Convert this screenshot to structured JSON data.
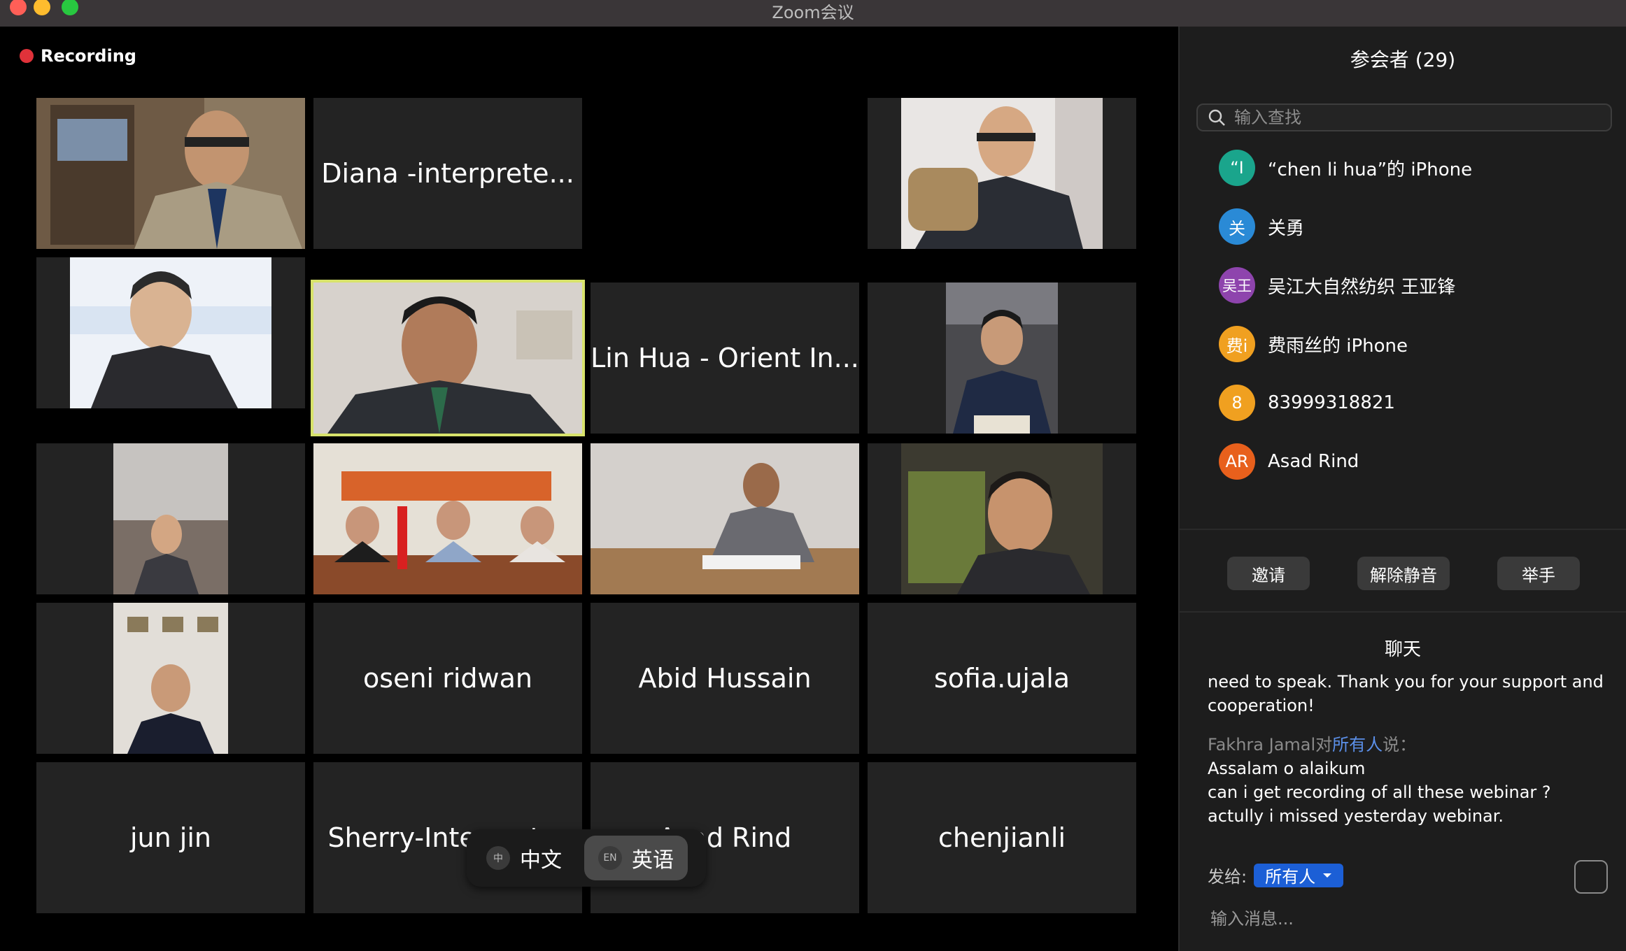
{
  "window": {
    "title": "Zoom会议"
  },
  "recording": {
    "label": "Recording"
  },
  "video_grid": {
    "tiles": [
      {
        "type": "video",
        "label": ""
      },
      {
        "type": "name",
        "label": "Diana -interprete..."
      },
      {
        "type": "empty",
        "label": ""
      },
      {
        "type": "video",
        "label": ""
      },
      {
        "type": "video",
        "label": ""
      },
      {
        "type": "video",
        "label": "",
        "active": true
      },
      {
        "type": "name",
        "label": "Lin Hua - Orient In..."
      },
      {
        "type": "video",
        "label": ""
      },
      {
        "type": "video",
        "label": ""
      },
      {
        "type": "video",
        "label": ""
      },
      {
        "type": "video",
        "label": ""
      },
      {
        "type": "video",
        "label": ""
      },
      {
        "type": "video",
        "label": ""
      },
      {
        "type": "name",
        "label": "oseni ridwan"
      },
      {
        "type": "name",
        "label": "Abid Hussain"
      },
      {
        "type": "name",
        "label": "sofia.ujala"
      },
      {
        "type": "name",
        "label": "jun jin"
      },
      {
        "type": "name",
        "label": "Sherry-Interpreter"
      },
      {
        "type": "name",
        "label": "Asad Rind"
      },
      {
        "type": "name",
        "label": "chenjianli"
      }
    ]
  },
  "interpretation": {
    "options": [
      {
        "icon_text": "中",
        "label": "中文",
        "selected": false
      },
      {
        "icon_text": "EN",
        "label": "英语",
        "selected": true
      }
    ]
  },
  "participants": {
    "title": "参会者 (29)",
    "search_placeholder": "输入查找",
    "items": [
      {
        "initials": "“I",
        "name": "“chen li hua”的 iPhone",
        "color": "#1aa58c"
      },
      {
        "initials": "关",
        "name": "关勇",
        "color": "#2a8ad6"
      },
      {
        "initials": "吴王",
        "name": "吴江大自然纺织 王亚锋",
        "color": "#8e44ad"
      },
      {
        "initials": "费i",
        "name": "费雨丝的 iPhone",
        "color": "#f0a020"
      },
      {
        "initials": "8",
        "name": "83999318821",
        "color": "#f0a020"
      },
      {
        "initials": "AR",
        "name": "Asad Rind",
        "color": "#e8601c"
      }
    ],
    "buttons": {
      "invite": "邀请",
      "unmute": "解除静音",
      "raise_hand": "举手"
    }
  },
  "chat": {
    "title": "聊天",
    "prev_message": "need to speak. Thank you for your support and cooperation!",
    "sender": "Fakhra Jamal",
    "to_word": "对",
    "recipient": "所有人",
    "said": "说：",
    "lines": [
      "Assalam o alaikum",
      "can i get recording of all these webinar ?",
      "actully i missed yesterday webinar."
    ],
    "send_to_label": "发给:",
    "send_to_value": "所有人",
    "input_placeholder": "输入消息..."
  },
  "colors": {
    "recording": "#e0323a",
    "active_speaker": "#d8e36b",
    "chat_recipient": "#5b8fe8",
    "send_to_button": "#1c5fd6"
  }
}
